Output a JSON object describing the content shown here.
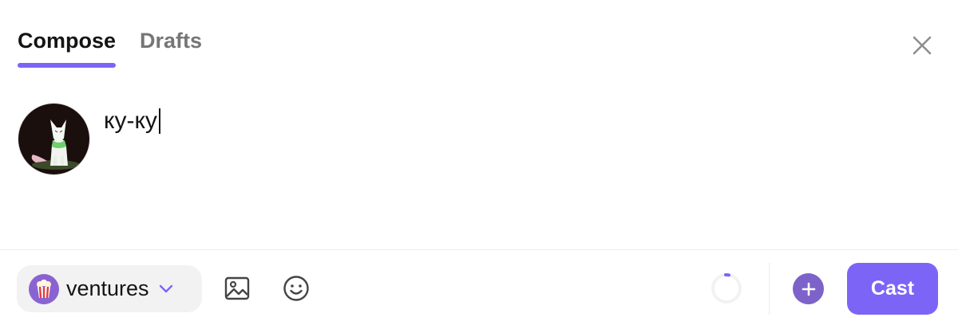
{
  "tabs": [
    {
      "label": "Compose",
      "active": true
    },
    {
      "label": "Drafts",
      "active": false
    }
  ],
  "close": {
    "icon": "close-icon"
  },
  "composer": {
    "text": "ку-ку"
  },
  "toolbar": {
    "channel": {
      "label": "ventures",
      "icon": "popcorn-icon"
    },
    "image_icon": "image-icon",
    "emoji_icon": "emoji-icon",
    "add_icon": "plus-icon",
    "cast_label": "Cast"
  },
  "colors": {
    "accent": "#7c65f6",
    "channel_icon_bg": "#8a63d2",
    "add_button_bg": "#7d63c9",
    "inactive_tab": "#767676"
  }
}
